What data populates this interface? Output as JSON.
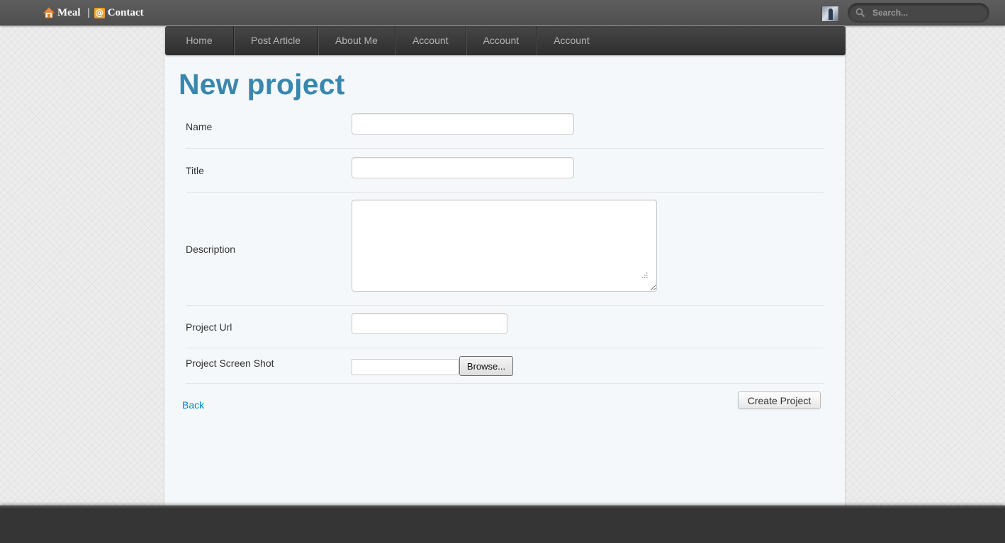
{
  "topbar": {
    "brand": {
      "home_label": "Meal",
      "separator": "|",
      "contact_label": "Contact"
    },
    "search": {
      "placeholder": "Search..."
    }
  },
  "nav": {
    "items": [
      {
        "label": "Home"
      },
      {
        "label": "Post Article"
      },
      {
        "label": "About Me"
      },
      {
        "label": "Account"
      },
      {
        "label": "Account"
      },
      {
        "label": "Account"
      }
    ]
  },
  "page": {
    "title": "New project"
  },
  "form": {
    "name_label": "Name",
    "name_value": "",
    "title_label": "Title",
    "title_value": "",
    "description_label": "Description",
    "description_value": "",
    "url_label": "Project Url",
    "url_value": "",
    "screenshot_label": "Project Screen Shot",
    "browse_label": "Browse...",
    "back_label": "Back",
    "submit_label": "Create Project"
  },
  "colors": {
    "title": "#3a87ad",
    "link": "#0088cc",
    "topbar": "#555555",
    "navbar": "#3a3a3a",
    "footer": "#353535",
    "accent_icon": "#f0a030"
  },
  "icons": {
    "home": "home-icon",
    "contact": "at-sign-icon",
    "search": "search-icon",
    "resize_grip": "resize-grip-icon"
  }
}
